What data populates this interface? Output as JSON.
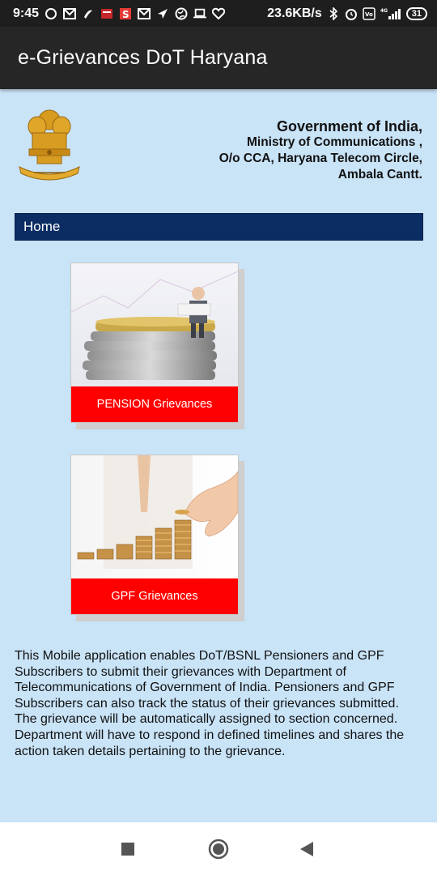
{
  "status_bar": {
    "time": "9:45",
    "network_speed": "23.6KB/s",
    "battery": "31",
    "signal_label": "4G"
  },
  "app_bar": {
    "title": "e-Grievances DoT Haryana"
  },
  "header": {
    "line1": "Government of India,",
    "line2": "Ministry of Communications ,",
    "line3": "O/o CCA, Haryana Telecom Circle,",
    "line4": "Ambala Cantt."
  },
  "nav": {
    "home_label": "Home"
  },
  "cards": [
    {
      "label": "PENSION Grievances",
      "icon": "coins-stack-businessman-image"
    },
    {
      "label": "GPF Grievances",
      "icon": "hand-stacking-coins-image"
    }
  ],
  "description": "This Mobile application enables DoT/BSNL Pensioners and GPF Subscribers to submit their grievances with Department of Telecommunications of Government of India. Pensioners and GPF Subscribers can also track the status of their grievances submitted. The grievance will be automatically assigned to section concerned. Department will have to respond in defined timelines and shares the action taken details pertaining to the grievance.",
  "colors": {
    "background": "#c9e3f7",
    "app_bar": "#262626",
    "nav_bar": "#0b2d63",
    "card_label": "#ff0000"
  }
}
